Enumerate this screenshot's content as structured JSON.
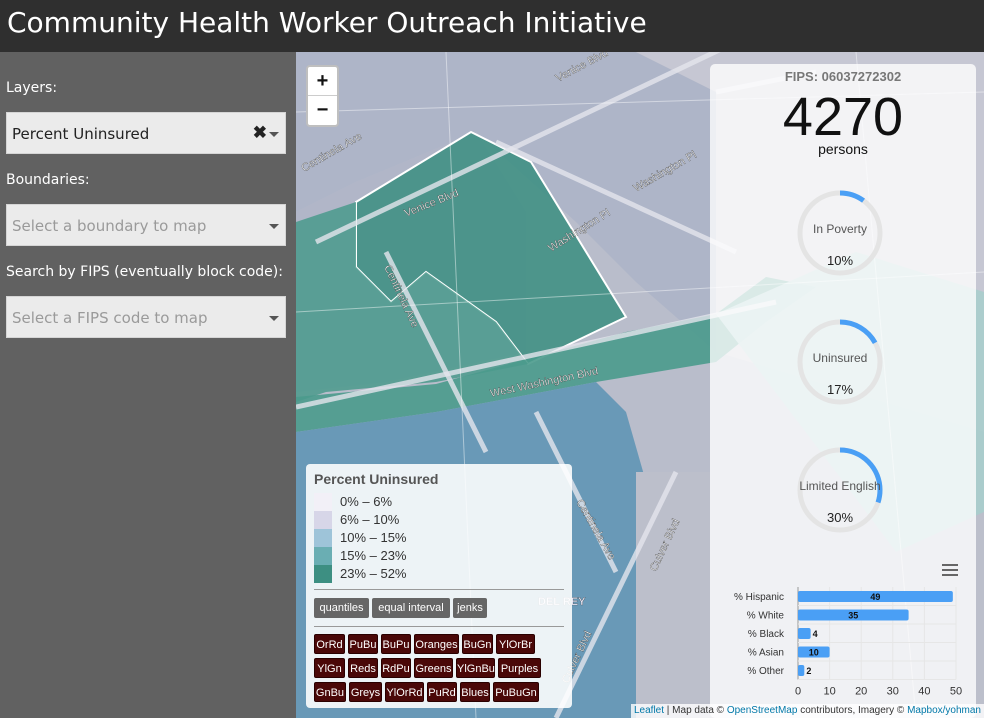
{
  "header": {
    "title": "Community Health Worker Outreach Initiative"
  },
  "sidebar": {
    "layers_label": "Layers:",
    "layers_value": "Percent Uninsured",
    "boundaries_label": "Boundaries:",
    "boundaries_placeholder": "Select a boundary to map",
    "fips_label": "Search by FIPS (eventually block code):",
    "fips_placeholder": "Select a FIPS code to map"
  },
  "map": {
    "streets": [
      "Venice Blvd",
      "Centinela Ave",
      "Washington Pl",
      "Washington Pl",
      "West Washington Blvd",
      "Centinela Ave",
      "Culver Blvd",
      "Culver Blvd",
      "DEL REY",
      "Centinela Ave",
      "Venice Blvd"
    ],
    "zoom_in": "+",
    "zoom_out": "−"
  },
  "legend": {
    "title": "Percent Uninsured",
    "classes": [
      {
        "label": "0% – 6%",
        "color": "#f2f0f7"
      },
      {
        "label": "6% – 10%",
        "color": "#d7d6e8"
      },
      {
        "label": "10% – 15%",
        "color": "#9ec4d9"
      },
      {
        "label": "15% – 23%",
        "color": "#6aaeb3"
      },
      {
        "label": "23% – 52%",
        "color": "#3d8f82"
      }
    ],
    "classification_buttons": [
      "quantiles",
      "equal interval",
      "jenks"
    ],
    "palettes": [
      [
        "OrRd",
        "PuBu",
        "BuPu",
        "Oranges",
        "BuGn",
        "YlOrBr"
      ],
      [
        "YlGn",
        "Reds",
        "RdPu",
        "Greens",
        "YlGnBu",
        "Purples"
      ],
      [
        "GnBu",
        "Greys",
        "YlOrRd",
        "PuRd",
        "Blues",
        "PuBuGn"
      ]
    ]
  },
  "info": {
    "fips": "FIPS: 06037272302",
    "population": "4270",
    "population_unit": "persons",
    "gauges": [
      {
        "label": "In Poverty",
        "value": "10%",
        "fraction": 0.1
      },
      {
        "label": "Uninsured",
        "value": "17%",
        "fraction": 0.17
      },
      {
        "label": "Limited English",
        "value": "30%",
        "fraction": 0.3
      }
    ],
    "gauge_color": "#4a9ff5"
  },
  "chart_data": {
    "type": "bar",
    "orientation": "horizontal",
    "categories": [
      "% Hispanic",
      "% White",
      "% Black",
      "% Asian",
      "% Other"
    ],
    "values": [
      49,
      35,
      4,
      10,
      2
    ],
    "xticks": [
      0,
      10,
      20,
      30,
      40,
      50
    ],
    "xlim": [
      0,
      50
    ],
    "bar_color": "#4a9ff5",
    "title": "",
    "xlabel": "",
    "ylabel": ""
  },
  "attribution": {
    "leaflet": "Leaflet",
    "sep": " | Map data © ",
    "osm": "OpenStreetMap",
    "mid": " contributors, Imagery © ",
    "mapbox": "Mapbox/yohman"
  }
}
